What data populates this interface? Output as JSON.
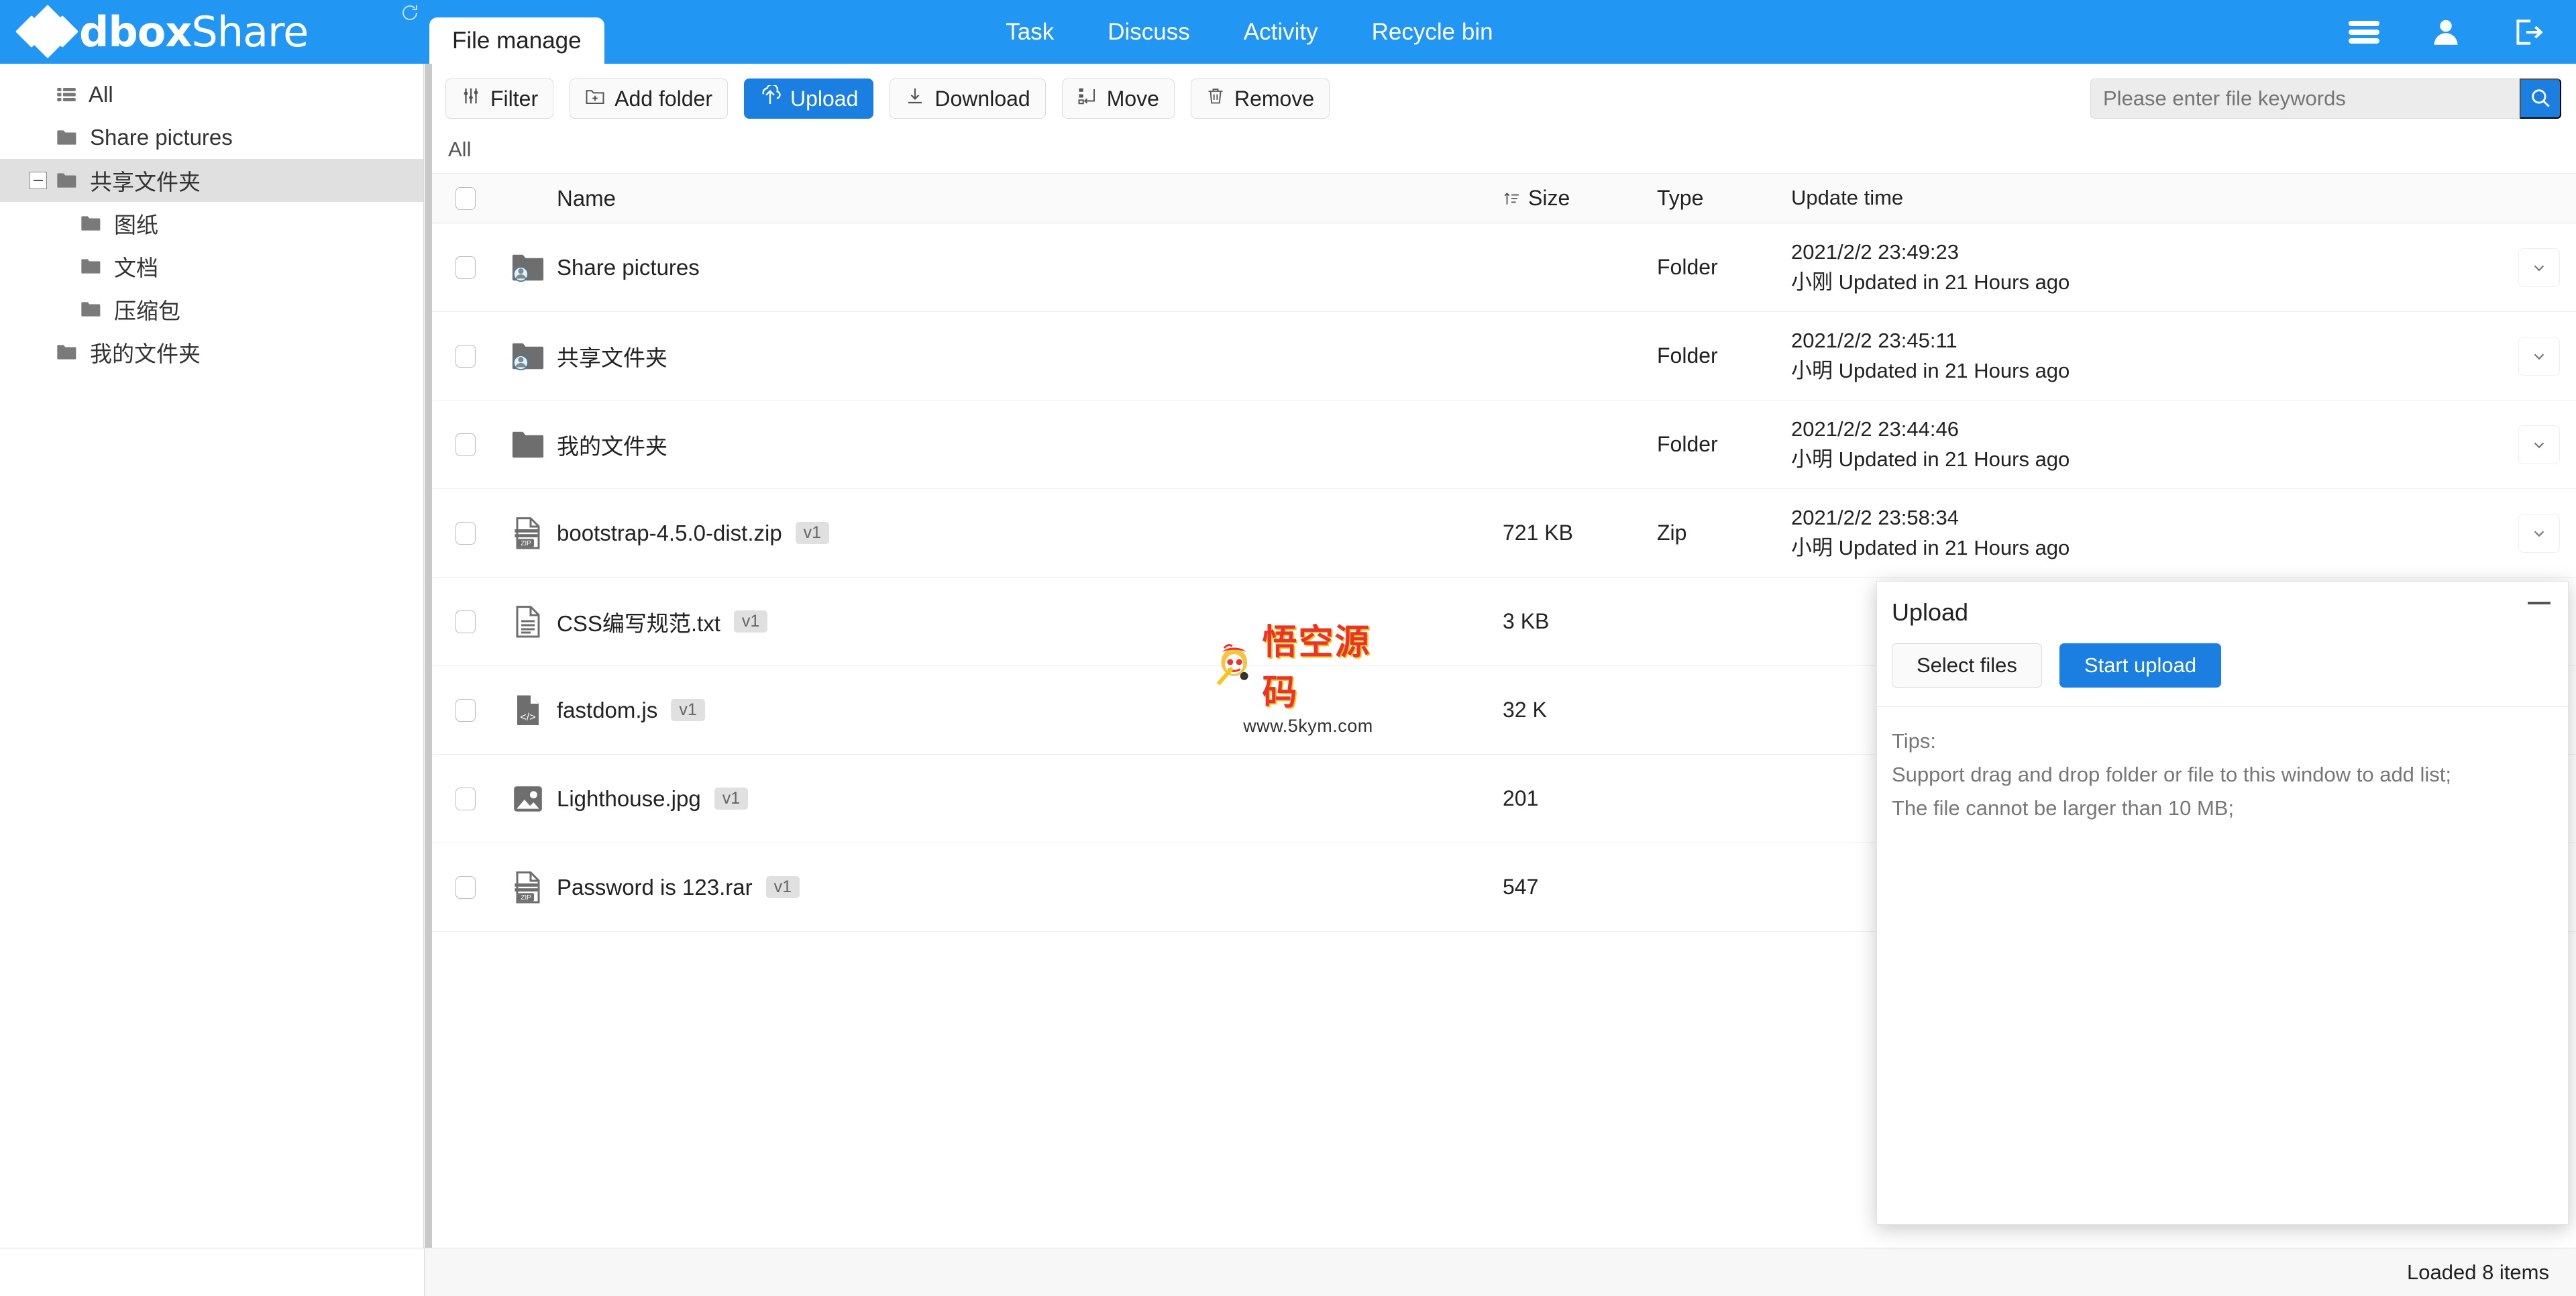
{
  "navbar": {
    "brand_bold": "dbox",
    "brand_light": "Share",
    "active_tab": "File manage",
    "links": [
      "Task",
      "Discuss",
      "Activity",
      "Recycle bin"
    ],
    "icons": [
      "menu-icon",
      "user-icon",
      "logout-icon"
    ],
    "accent_color": "#2196f3"
  },
  "sidebar": {
    "items": [
      {
        "label": "All",
        "icon": "list-icon",
        "level": 0,
        "expander": "",
        "selected": false
      },
      {
        "label": "Share pictures",
        "icon": "folder-icon",
        "level": 0,
        "expander": "",
        "selected": false
      },
      {
        "label": "共享文件夹",
        "icon": "folder-icon",
        "level": 0,
        "expander": "minus",
        "selected": true
      },
      {
        "label": "图纸",
        "icon": "folder-icon",
        "level": 1,
        "expander": "",
        "selected": false
      },
      {
        "label": "文档",
        "icon": "folder-icon",
        "level": 1,
        "expander": "",
        "selected": false
      },
      {
        "label": "压缩包",
        "icon": "folder-icon",
        "level": 1,
        "expander": "",
        "selected": false
      },
      {
        "label": "我的文件夹",
        "icon": "folder-icon",
        "level": 0,
        "expander": "",
        "selected": false
      }
    ]
  },
  "toolbar": {
    "buttons": [
      {
        "label": "Filter",
        "icon": "filter-icon",
        "primary": false
      },
      {
        "label": "Add folder",
        "icon": "add-folder-icon",
        "primary": false
      },
      {
        "label": "Upload",
        "icon": "upload-icon",
        "primary": true
      },
      {
        "label": "Download",
        "icon": "download-icon",
        "primary": false
      },
      {
        "label": "Move",
        "icon": "move-icon",
        "primary": false
      },
      {
        "label": "Remove",
        "icon": "trash-icon",
        "primary": false
      }
    ],
    "primary_color": "#1a7fe0"
  },
  "search": {
    "placeholder": "Please enter file keywords",
    "value": "",
    "button_icon": "search-icon"
  },
  "breadcrumb": {
    "text": "All"
  },
  "table": {
    "headers": {
      "name": "Name",
      "size": "Size",
      "type": "Type",
      "update_time": "Update time",
      "size_sort_icon": "sort-ascending-icon"
    },
    "rows": [
      {
        "icon": "shared-folder-icon",
        "name": "Share pictures",
        "version": "",
        "size": "",
        "type": "Folder",
        "time": "2021/2/2 23:49:23",
        "author_line": "小刚 Updated in 21 Hours ago"
      },
      {
        "icon": "shared-folder-icon",
        "name": "共享文件夹",
        "version": "",
        "size": "",
        "type": "Folder",
        "time": "2021/2/2 23:45:11",
        "author_line": "小明 Updated in 21 Hours ago"
      },
      {
        "icon": "folder-icon",
        "name": "我的文件夹",
        "version": "",
        "size": "",
        "type": "Folder",
        "time": "2021/2/2 23:44:46",
        "author_line": "小明 Updated in 21 Hours ago"
      },
      {
        "icon": "zip-icon",
        "name": "bootstrap-4.5.0-dist.zip",
        "version": "v1",
        "size": "721 KB",
        "type": "Zip",
        "time": "2021/2/2 23:58:34",
        "author_line": "小明 Updated in 21 Hours ago"
      },
      {
        "icon": "text-icon",
        "name": "CSS编写规范.txt",
        "version": "v1",
        "size": "3 KB",
        "type": "",
        "time": "",
        "author_line": ""
      },
      {
        "icon": "code-icon",
        "name": "fastdom.js",
        "version": "v1",
        "size": "32 K",
        "type": "",
        "time": "",
        "author_line": ""
      },
      {
        "icon": "image-icon",
        "name": "Lighthouse.jpg",
        "version": "v1",
        "size": "201",
        "type": "",
        "time": "",
        "author_line": ""
      },
      {
        "icon": "zip-icon",
        "name": "Password is 123.rar",
        "version": "v1",
        "size": "547",
        "type": "",
        "time": "",
        "author_line": ""
      }
    ],
    "row_more_icon": "chevron-down-icon"
  },
  "upload_panel": {
    "title": "Upload",
    "minimize_icon": "minimize-icon",
    "select_files_label": "Select files",
    "start_upload_label": "Start upload",
    "tips_title": "Tips:",
    "tips": [
      "Support drag and drop folder or file to this window to add list;",
      "The file cannot be larger than 10 MB;"
    ]
  },
  "watermark": {
    "text_cn": "悟空源码",
    "url": "www.5kym.com"
  },
  "statusbar": {
    "text": "Loaded 8 items"
  }
}
